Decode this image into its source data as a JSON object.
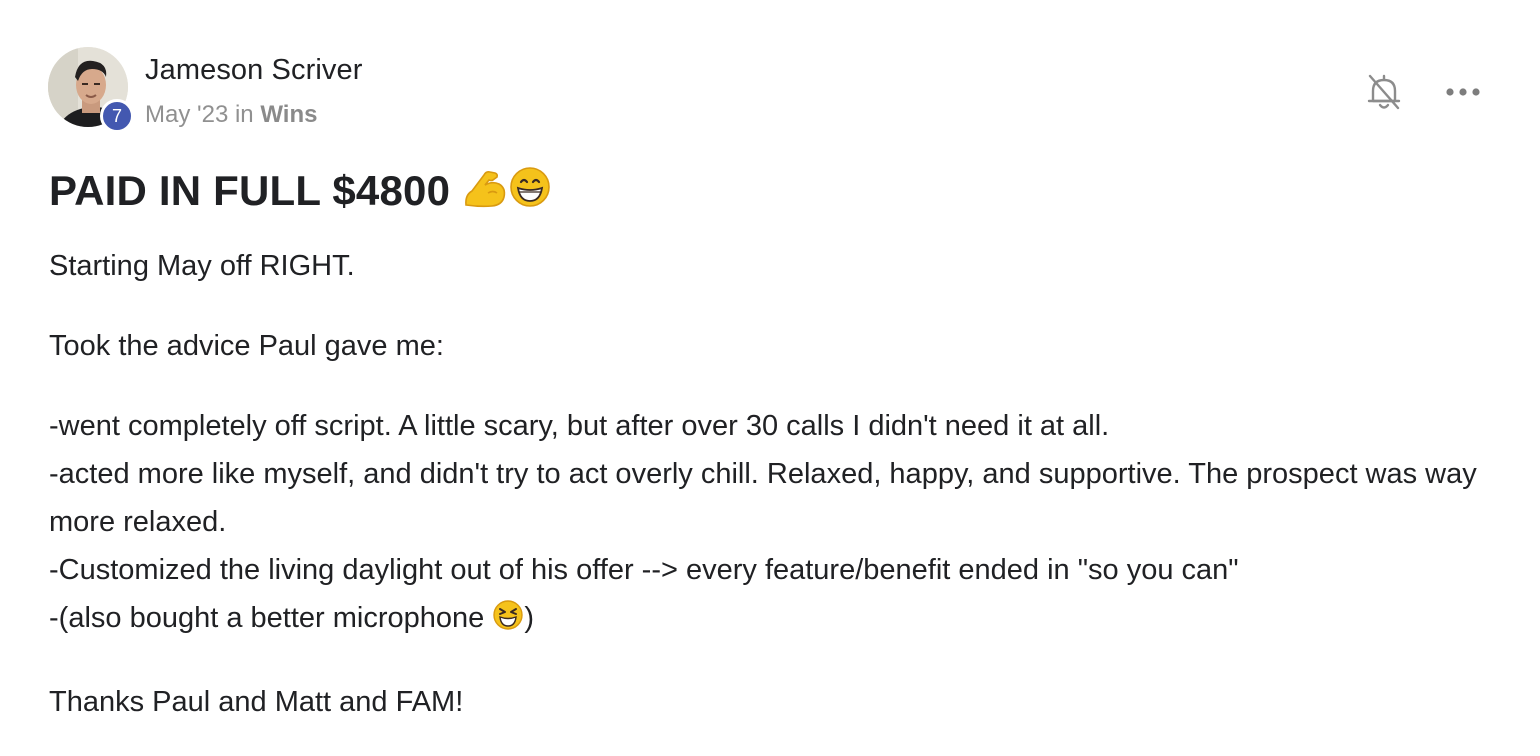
{
  "author": {
    "name": "Jameson Scriver",
    "level": "7",
    "date": "May '23",
    "in_word": "in",
    "category": "Wins"
  },
  "icons": {
    "bell": "bell-off-icon",
    "more": "more-horizontal-icon",
    "flexed_biceps": "flexed-biceps-emoji",
    "grinning": "grinning-face-emoji",
    "squinting": "squinting-face-emoji"
  },
  "colors": {
    "badge": "#4358b0",
    "text": "#202124",
    "meta": "#909090",
    "emoji_yellow": "#f5c21b"
  },
  "post": {
    "title": "PAID IN FULL $4800",
    "intro": "Starting May off RIGHT.",
    "advice_intro": "Took the advice Paul gave me:",
    "line1": "-went completely off script. A little scary, but after over 30 calls I didn't need it at all.",
    "line2": "-acted more like myself, and didn't try to act overly chill. Relaxed, happy, and supportive. The prospect was way more relaxed.",
    "line3": "-Customized the living daylight out of his offer --> every feature/benefit ended in \"so you can\"",
    "line4_text": "-(also bought a better microphone ",
    "line4_close": ")",
    "thanks": "Thanks Paul and Matt and FAM!"
  }
}
